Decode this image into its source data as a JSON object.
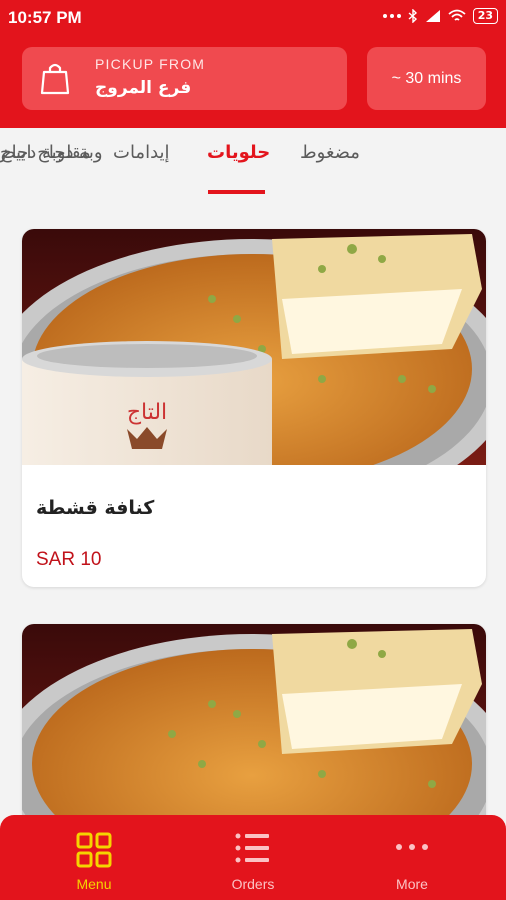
{
  "status_bar": {
    "time": "10:57 PM",
    "battery": "23"
  },
  "pickup": {
    "label": "PICKUP FROM",
    "branch": "فرع المروج"
  },
  "eta": {
    "label": "~ 30 mins"
  },
  "tabs": [
    {
      "label": "وبة دجاج ابيض"
    },
    {
      "label": "مضغوط"
    },
    {
      "label": "حلويات",
      "active": true
    },
    {
      "label": "إيدامات"
    },
    {
      "label": "مقلوبة دجاج"
    }
  ],
  "items": [
    {
      "name": "كنافة قشطة",
      "price": "SAR 10"
    },
    {
      "name": "",
      "price": ""
    }
  ],
  "bottom_nav": [
    {
      "label": "Menu",
      "icon": "grid-icon",
      "active": true
    },
    {
      "label": "Orders",
      "icon": "list-icon"
    },
    {
      "label": "More",
      "icon": "more-dots-icon"
    }
  ],
  "colors": {
    "primary": "#e3141c",
    "accent_yellow": "#f5d400",
    "price": "#c1121a"
  }
}
